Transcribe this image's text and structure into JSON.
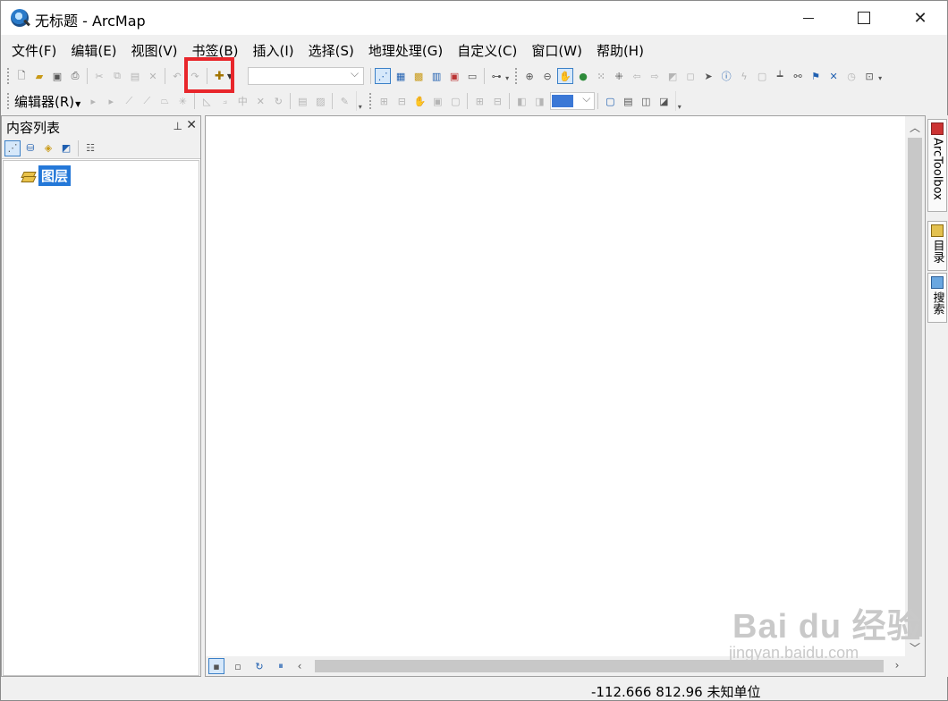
{
  "window": {
    "title": "无标题 - ArcMap"
  },
  "menubar": {
    "items": [
      "文件(F)",
      "编辑(E)",
      "视图(V)",
      "书签(B)",
      "插入(I)",
      "选择(S)",
      "地理处理(G)",
      "自定义(C)",
      "窗口(W)",
      "帮助(H)"
    ]
  },
  "toolbar": {
    "add_data_icon": "add-data-plus-icon",
    "highlight_color": "#e8262b"
  },
  "editor_toolbar": {
    "label": "编辑器(R)"
  },
  "toc": {
    "title": "内容列表",
    "layer_name": "图层"
  },
  "dock": {
    "arctoolbox": "ArcToolbox",
    "catalog": "目录",
    "search": "搜索"
  },
  "statusbar": {
    "coords": "-112.666  812.96 未知单位"
  },
  "watermark": {
    "brand": "Bai du 经验",
    "url": "jingyan.baidu.com"
  },
  "colors": {
    "selection": "#2478d8",
    "accent": "#3b80c7"
  }
}
